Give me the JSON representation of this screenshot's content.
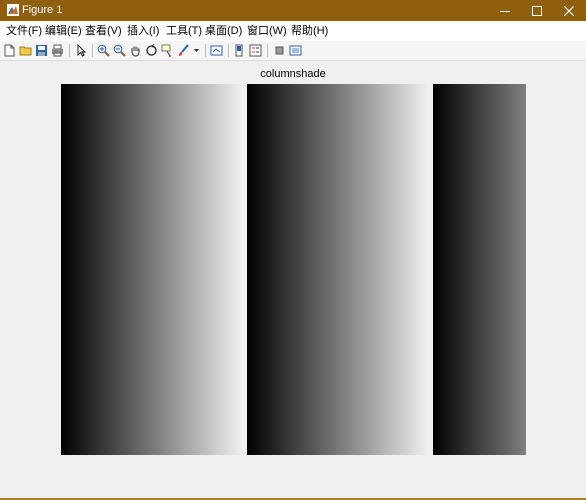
{
  "window": {
    "title": "Figure 1",
    "titlebar_color": "#8f5f0e"
  },
  "menu": {
    "items": [
      {
        "label": "文件(F)"
      },
      {
        "label": "编辑(E)"
      },
      {
        "label": "查看(V)"
      },
      {
        "label": "插入(I)"
      },
      {
        "label": "工具(T)"
      },
      {
        "label": "桌面(D)"
      },
      {
        "label": "窗口(W)"
      },
      {
        "label": "帮助(H)"
      }
    ]
  },
  "toolbar": {
    "icons": [
      "new-figure-icon",
      "open-file-icon",
      "save-icon",
      "print-icon",
      "select-arrow-icon",
      "zoom-in-icon",
      "zoom-out-icon",
      "pan-hand-icon",
      "rotate-3d-icon",
      "data-cursor-icon",
      "brush-icon",
      "brush-dropdown-icon",
      "link-plot-icon",
      "insert-colorbar-icon",
      "insert-legend-icon",
      "hide-plot-tools-icon",
      "show-plot-tools-icon"
    ]
  },
  "figure": {
    "title": "columnshade",
    "columns": [
      {
        "name": "column-1",
        "gradient_from": "#000000",
        "gradient_to": "#f0f0f0"
      },
      {
        "name": "column-2",
        "gradient_from": "#000000",
        "gradient_to": "#f0f0f0"
      },
      {
        "name": "column-3",
        "gradient_from": "#000000",
        "gradient_to": "#808080"
      }
    ]
  }
}
